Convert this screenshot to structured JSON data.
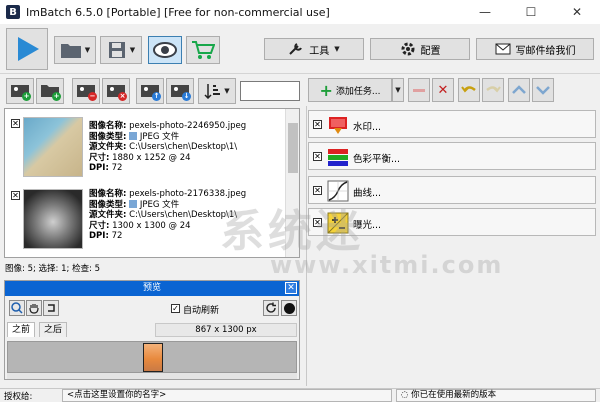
{
  "window": {
    "title": "ImBatch 6.5.0 [Portable] [Free for non-commercial use]",
    "minimize": "—",
    "maximize": "☐",
    "close": "✕"
  },
  "toolbar": {
    "tools_label": "工具",
    "config_label": "配置",
    "mail_label": "写邮件给我们"
  },
  "images": [
    {
      "name_key": "图像名称:",
      "name": "pexels-photo-2246950.jpeg",
      "type_key": "图像类型:",
      "type": "JPEG 文件",
      "folder_key": "源文件夹:",
      "folder": "C:\\Users\\chen\\Desktop\\1\\",
      "size_key": "尺寸:",
      "size": "1880 x 1252 @ 24",
      "dpi_key": "DPI:",
      "dpi": "72",
      "checked": "✕"
    },
    {
      "name_key": "图像名称:",
      "name": "pexels-photo-2176338.jpeg",
      "type_key": "图像类型:",
      "type": "JPEG 文件",
      "folder_key": "源文件夹:",
      "folder": "C:\\Users\\chen\\Desktop\\1\\",
      "size_key": "尺寸:",
      "size": "1300 x 1300 @ 24",
      "dpi_key": "DPI:",
      "dpi": "72",
      "checked": "✕"
    }
  ],
  "status": {
    "summary": "图像: 5; 选择: 1; 检查: 5"
  },
  "preview": {
    "title": "预览",
    "close": "✕",
    "auto_refresh_label": "自动刷新",
    "auto_refresh_check": "✓",
    "tab_before": "之前",
    "tab_after": "之后",
    "dimensions": "867 x 1300 px"
  },
  "tasks": {
    "add_label": "添加任务...",
    "items": [
      {
        "label": "水印...",
        "checked": "✕"
      },
      {
        "label": "色彩平衡...",
        "checked": "✕"
      },
      {
        "label": "曲线...",
        "checked": "✕"
      },
      {
        "label": "曝光...",
        "checked": "✕"
      }
    ]
  },
  "footer": {
    "auth_label": "授权给:",
    "auth_value": "<点击这里设置你的名字>",
    "version_status": "你已在使用最新的版本"
  },
  "watermark": {
    "text": "系统迷",
    "url": "www.xitmi.com"
  },
  "colors": {
    "accent": "#0a64d2",
    "play": "#2a8ad4",
    "cart": "#17a74a"
  }
}
